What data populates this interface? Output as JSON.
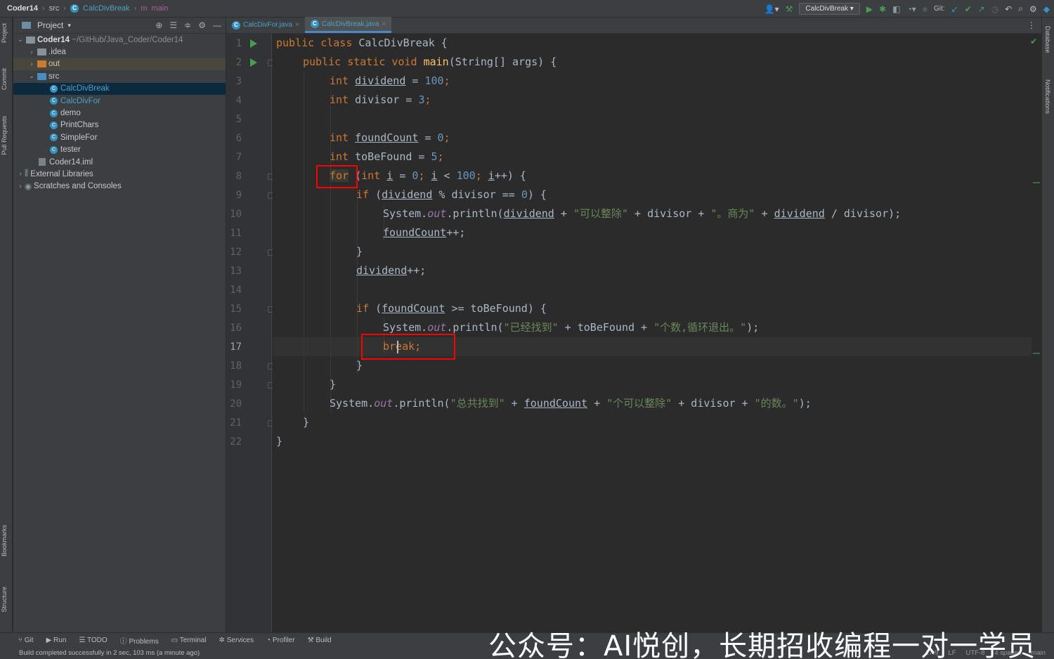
{
  "breadcrumb": {
    "project": "Coder14",
    "folder": "src",
    "class": "CalcDivBreak",
    "method": "main"
  },
  "toolbar": {
    "run_config": "CalcDivBreak",
    "git_label": "Git:"
  },
  "left_strip": [
    "Project",
    "Commit",
    "Pull Requests",
    "Bookmarks",
    "Structure"
  ],
  "right_strip": [
    "Database",
    "Notifications"
  ],
  "project_panel": {
    "title": "Project",
    "root": {
      "name": "Coder14",
      "path": "~/GitHub/Java_Coder/Coder14"
    },
    "items": {
      "idea": ".idea",
      "out": "out",
      "src": "src",
      "c1": "CalcDivBreak",
      "c2": "CalcDivFor",
      "c3": "demo",
      "c4": "PrintChars",
      "c5": "SimpleFor",
      "c6": "tester",
      "iml": "Coder14.iml",
      "ext": "External Libraries",
      "scratch": "Scratches and Consoles"
    }
  },
  "tabs": [
    "CalcDivFor.java",
    "CalcDivBreak.java"
  ],
  "line_numbers": [
    "1",
    "2",
    "3",
    "4",
    "5",
    "6",
    "7",
    "8",
    "9",
    "10",
    "11",
    "12",
    "13",
    "14",
    "15",
    "16",
    "17",
    "18",
    "19",
    "20",
    "21",
    "22"
  ],
  "code": {
    "l1": [
      "public class ",
      "CalcDivBreak {"
    ],
    "l2": [
      "public static void ",
      "main",
      "(String[] args) {"
    ],
    "l3": [
      "int ",
      "dividend",
      " = ",
      "100",
      ";"
    ],
    "l4": [
      "int ",
      "divisor = ",
      "3",
      ";"
    ],
    "l6": [
      "int ",
      "foundCount",
      " = ",
      "0",
      ";"
    ],
    "l7": [
      "int ",
      "toBeFound = ",
      "5",
      ";"
    ],
    "l8": [
      "for",
      " (",
      "int ",
      "i",
      " = ",
      "0",
      "; ",
      "i",
      " < ",
      "100",
      "; ",
      "i",
      "++) {"
    ],
    "l9": [
      "if",
      " (",
      "dividend",
      " % divisor == ",
      "0",
      ") {"
    ],
    "l10": [
      "System.",
      "out",
      ".println(",
      "dividend",
      " + ",
      "\"可以整除\"",
      " + divisor + ",
      "\"。商为\"",
      " + ",
      "dividend",
      " / divisor);"
    ],
    "l11": [
      "foundCount",
      "++;"
    ],
    "l12": [
      "}"
    ],
    "l13": [
      "dividend",
      "++;"
    ],
    "l15": [
      "if",
      " (",
      "foundCount",
      " >= toBeFound) {"
    ],
    "l16": [
      "System.",
      "out",
      ".println(",
      "\"已经找到\"",
      " + toBeFound + ",
      "\"个数,循环退出。\"",
      ");"
    ],
    "l17": [
      "break",
      ";"
    ],
    "l18": [
      "}"
    ],
    "l19": [
      "}"
    ],
    "l20": [
      "System.",
      "out",
      ".println(",
      "\"总共找到\"",
      " + ",
      "foundCount",
      " + ",
      "\"个可以整除\"",
      " + divisor + ",
      "\"的数。\"",
      ");"
    ],
    "l21": [
      "}"
    ],
    "l22": [
      "}"
    ]
  },
  "bottom_tools": [
    "Git",
    "Run",
    "TODO",
    "Problems",
    "Terminal",
    "Services",
    "Profiler",
    "Build"
  ],
  "status": {
    "message": "Build completed successfully in 2 sec, 103 ms (a minute ago)",
    "pos": "17:9",
    "lf": "LF",
    "enc": "UTF-8",
    "indent": "4 spaces",
    "branch": "main"
  },
  "watermark": "公众号：AI悦创，长期招收编程一对一学员",
  "colors": {
    "keyword": "#cc7832",
    "number": "#6897bb",
    "string": "#6a8759",
    "method": "#ffc66d",
    "static": "#9876aa",
    "highlight": "#ff0000"
  }
}
